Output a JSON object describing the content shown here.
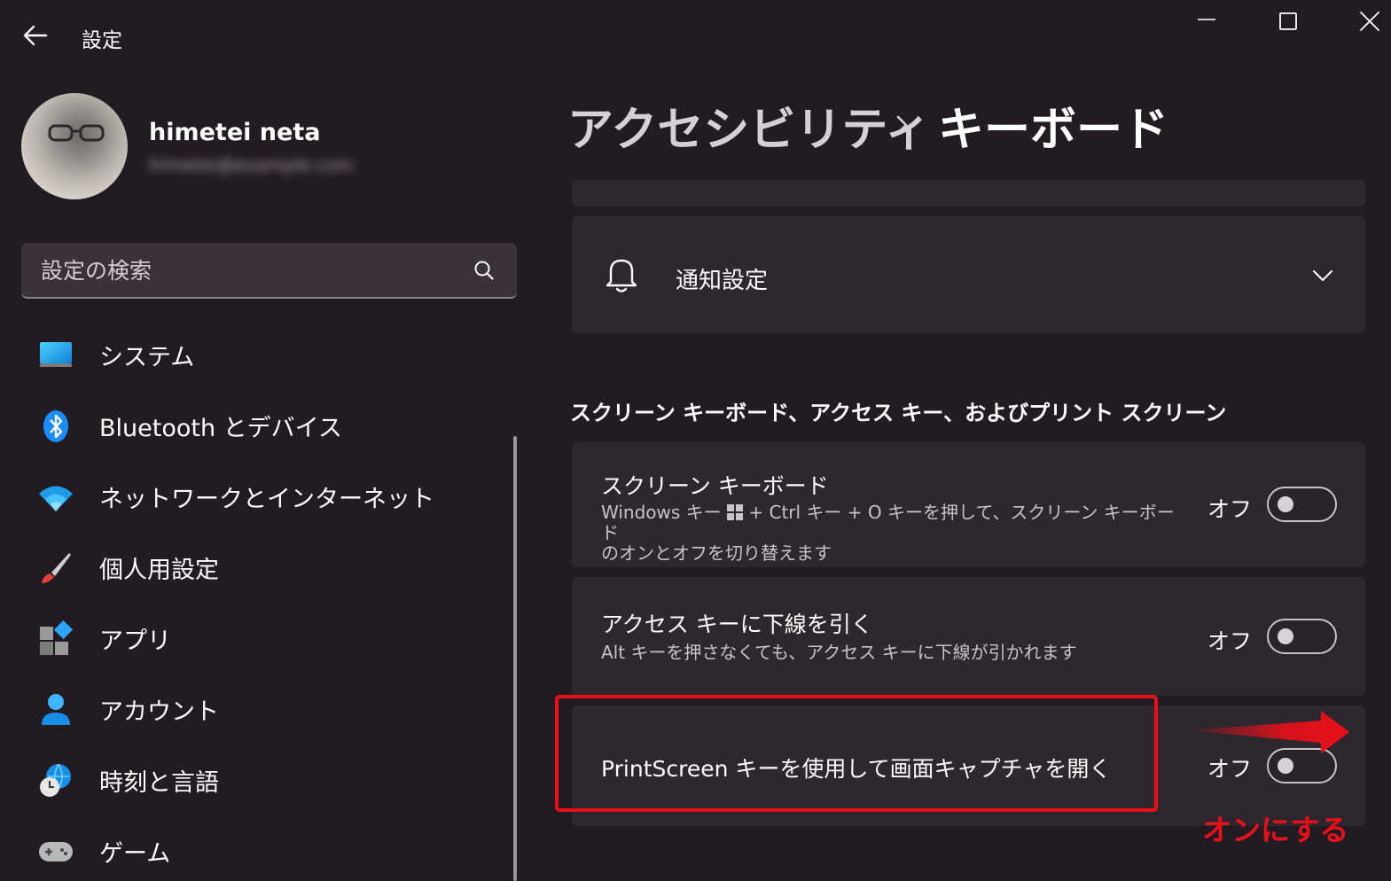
{
  "window": {
    "title": "設定",
    "back_icon": "back-arrow-icon",
    "controls": [
      "minimize-icon",
      "maximize-icon",
      "close-icon"
    ]
  },
  "profile": {
    "name": "himetei neta",
    "email": "himetei@example.com"
  },
  "search": {
    "placeholder": "設定の検索",
    "icon": "search-icon"
  },
  "sidebar": {
    "items": [
      {
        "label": "システム",
        "icon": "system-display-icon"
      },
      {
        "label": "Bluetooth とデバイス",
        "icon": "bluetooth-icon"
      },
      {
        "label": "ネットワークとインターネット",
        "icon": "wifi-icon"
      },
      {
        "label": "個人用設定",
        "icon": "paintbrush-icon"
      },
      {
        "label": "アプリ",
        "icon": "apps-icon"
      },
      {
        "label": "アカウント",
        "icon": "account-icon"
      },
      {
        "label": "時刻と言語",
        "icon": "time-language-icon"
      },
      {
        "label": "ゲーム",
        "icon": "gamepad-icon"
      }
    ]
  },
  "breadcrumb": {
    "parent": "アクセシビリティ",
    "separator_icon": "chevron-right-icon",
    "current": "キーボード"
  },
  "notifications": {
    "label": "通知設定",
    "icon": "bell-icon",
    "expand_icon": "chevron-down-icon"
  },
  "section": {
    "title": "スクリーン キーボード、アクセス キー、およびプリント スクリーン"
  },
  "settings": [
    {
      "title": "スクリーン キーボード",
      "desc_line1": "Windows キー ",
      "desc_line1b": " + Ctrl キー + O キーを押して、スクリーン キーボード",
      "desc_line2": "のオンとオフを切り替えます",
      "state": "オフ",
      "on": false
    },
    {
      "title": "アクセス キーに下線を引く",
      "desc": "Alt キーを押さなくても、アクセス キーに下線が引かれます",
      "state": "オフ",
      "on": false
    },
    {
      "title": "PrintScreen キーを使用して画面キャプチャを開く",
      "state": "オフ",
      "on": false
    }
  ],
  "annotation": {
    "text": "オンにする",
    "color": "#e8101a"
  },
  "colors": {
    "background": "#221b21",
    "card": "#2e272d",
    "accent_red": "#e8101a"
  }
}
